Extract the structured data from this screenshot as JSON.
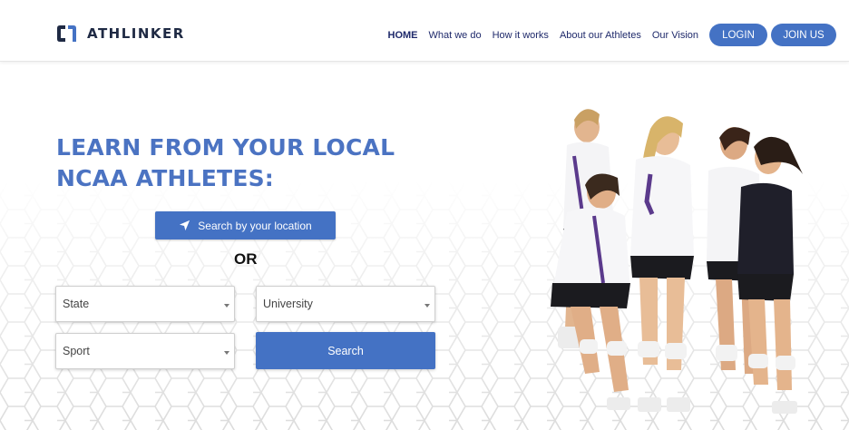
{
  "brand": {
    "name": "ATHLINKER",
    "accent": "#4472c4",
    "headline_color": "#4b73c2"
  },
  "nav": {
    "links": [
      "HOME",
      "What we do",
      "How it works",
      "About our Athletes",
      "Our Vision"
    ],
    "login_label": "LOGIN",
    "join_label": "JOIN US"
  },
  "hero": {
    "headline": "LEARN FROM YOUR LOCAL NCAA ATHLETES:",
    "location_button": "Search by your location",
    "location_icon": "navigation-arrow-icon",
    "or_text": "OR",
    "state_select": "State",
    "university_select": "University",
    "sport_select": "Sport",
    "search_button": "Search"
  },
  "photo": {
    "subject": "volleyball-team-celebrating"
  }
}
